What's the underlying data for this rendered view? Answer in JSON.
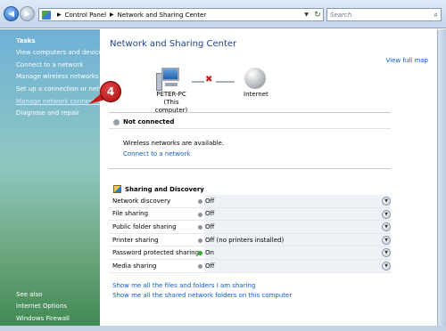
{
  "address": {
    "crumbs": [
      "Control Panel",
      "Network and Sharing Center"
    ],
    "search_placeholder": "Search"
  },
  "sidebar": {
    "tasks_header": "Tasks",
    "tasks": [
      "View computers and devices",
      "Connect to a network",
      "Manage wireless networks",
      "Set up a connection or network",
      "Manage network connections",
      "Diagnose and repair"
    ],
    "see_also_header": "See also",
    "see_also": [
      "Internet Options",
      "Windows Firewall"
    ]
  },
  "callout": {
    "number": "4"
  },
  "main": {
    "title": "Network and Sharing Center",
    "view_full_map": "View full map",
    "computer_name": "PETER-PC",
    "computer_sub": "(This computer)",
    "internet_label": "Internet",
    "status_header": "Not connected",
    "wireless_text": "Wireless networks are available.",
    "connect_link": "Connect to a network",
    "sharing_header": "Sharing and Discovery",
    "sharing": [
      {
        "name": "Network discovery",
        "value": "Off",
        "state": "off"
      },
      {
        "name": "File sharing",
        "value": "Off",
        "state": "off"
      },
      {
        "name": "Public folder sharing",
        "value": "Off",
        "state": "off"
      },
      {
        "name": "Printer sharing",
        "value": "Off (no printers installed)",
        "state": "off"
      },
      {
        "name": "Password protected sharing",
        "value": "On",
        "state": "on"
      },
      {
        "name": "Media sharing",
        "value": "Off",
        "state": "off"
      }
    ],
    "link_files": "Show me all the files and folders I am sharing",
    "link_folders": "Show me all the shared network folders on this computer"
  }
}
